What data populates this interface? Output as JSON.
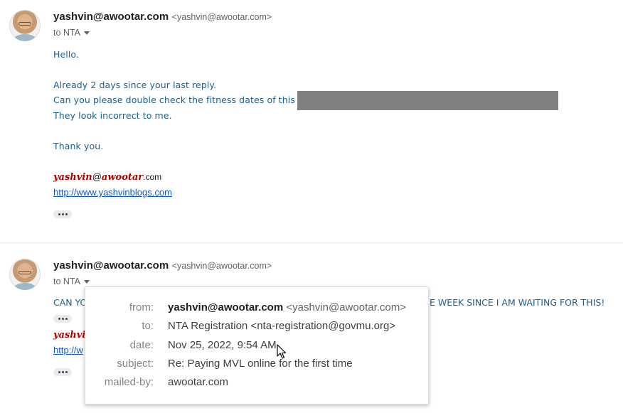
{
  "message1": {
    "sender_name": "yashvin@awootar.com",
    "sender_email": "<yashvin@awootar.com>",
    "to": "to NTA",
    "body": [
      "Hello.",
      "Already 2 days since your last reply.",
      "Can you please double check the fitness dates of this",
      "They look incorrect to me.",
      "Thank you."
    ],
    "signature": {
      "part1": "yashvin",
      "at": "@",
      "part2": "awootar",
      "tld": ".com"
    },
    "link": "http://www.yashvinblogs.com"
  },
  "message2": {
    "sender_name": "yashvin@awootar.com",
    "sender_email": "<yashvin@awootar.com>",
    "to": "to NTA",
    "body_left": "CAN YO",
    "body_right": "E WEEK SINCE I AM WAITING FOR THIS!",
    "signature_partial": "yashvi",
    "link_partial": "http://w"
  },
  "details_popup": {
    "rows": [
      {
        "label": "from:",
        "value_bold": "yashvin@awootar.com",
        "value_muted": "<yashvin@awootar.com>"
      },
      {
        "label": "to:",
        "value": "NTA Registration <nta-registration@govmu.org>"
      },
      {
        "label": "date:",
        "value": "Nov 25, 2022, 9:54 AM"
      },
      {
        "label": "subject:",
        "value": "Re: Paying MVL online for the first time"
      },
      {
        "label": "mailed-by:",
        "value": "awootar.com"
      }
    ]
  },
  "colors": {
    "body_text": "#1a5f8f",
    "signature_red": "#aa0000",
    "link": "#1155cc",
    "redaction": "#808080"
  },
  "icons": [
    "avatar",
    "dropdown-caret-icon",
    "more-dots-icon",
    "mouse-cursor-icon"
  ]
}
